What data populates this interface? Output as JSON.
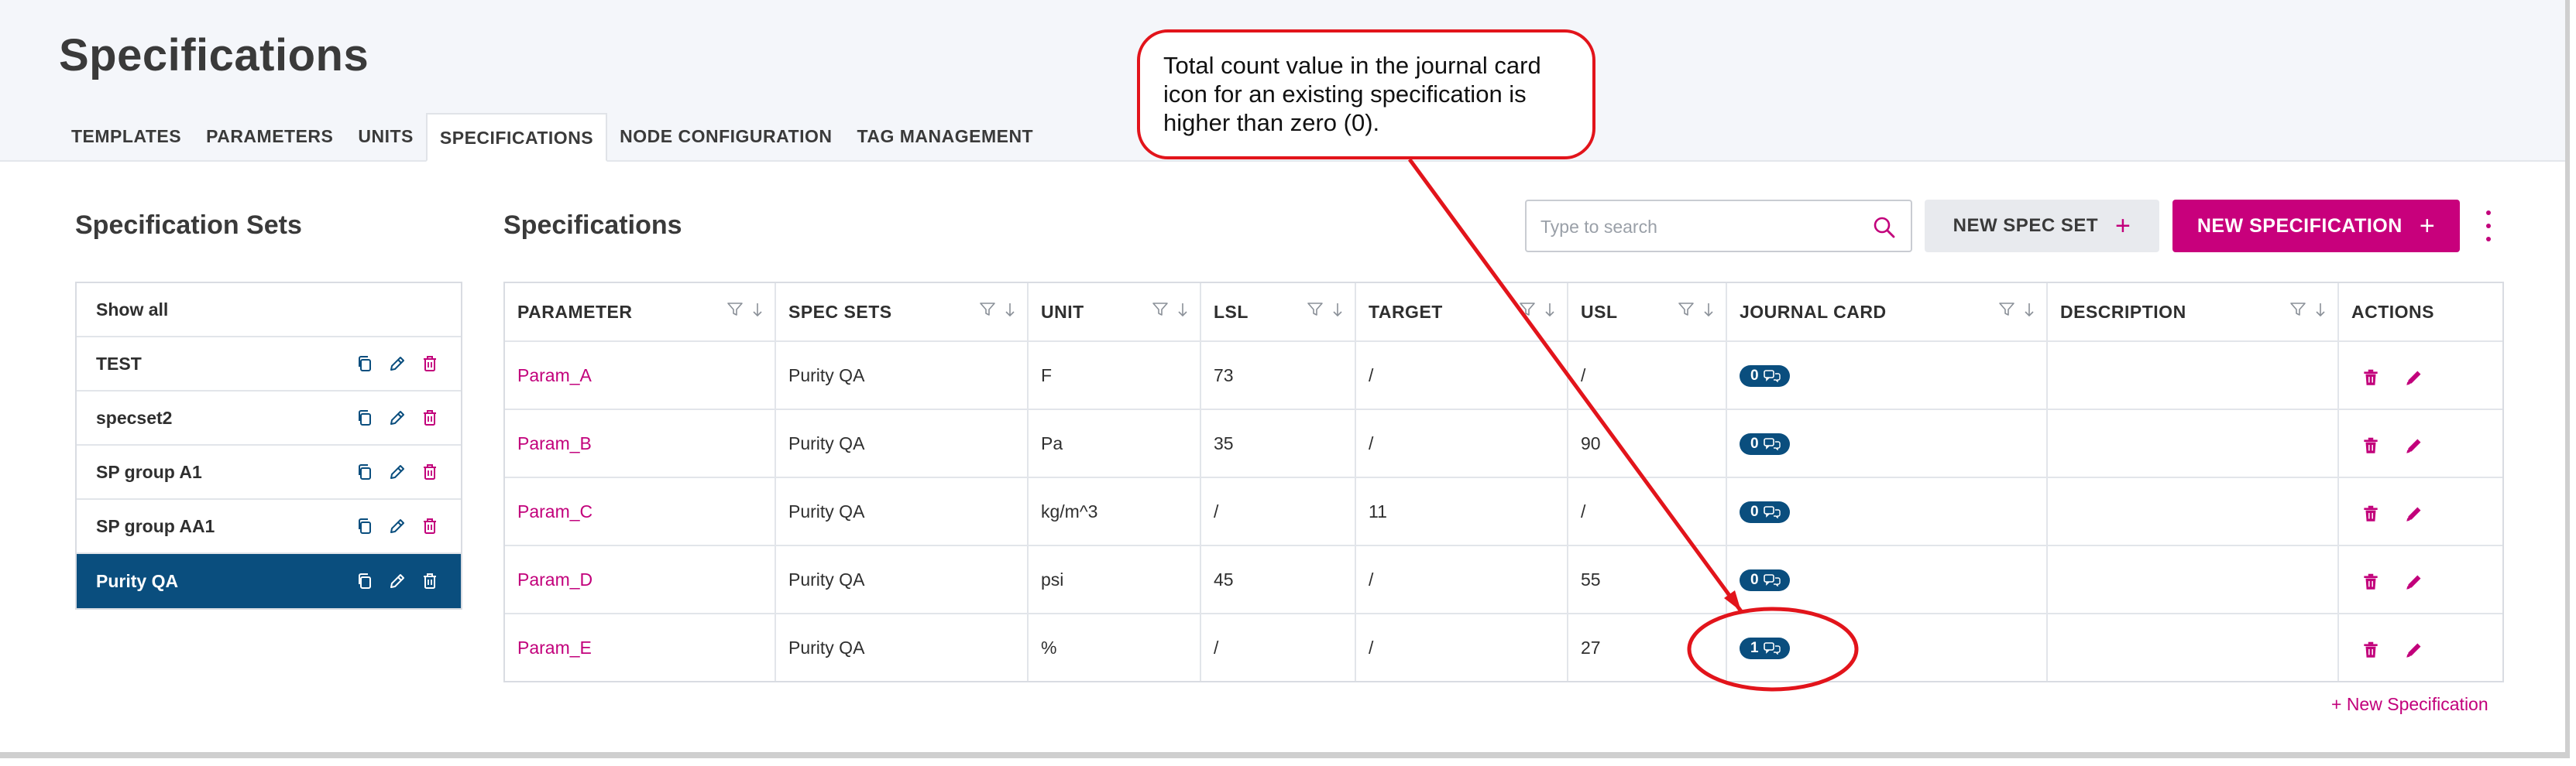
{
  "page": {
    "title": "Specifications"
  },
  "tabs": [
    "TEMPLATES",
    "PARAMETERS",
    "UNITS",
    "SPECIFICATIONS",
    "NODE CONFIGURATION",
    "TAG MANAGEMENT"
  ],
  "active_tab": "SPECIFICATIONS",
  "sets_panel": {
    "title": "Specification Sets",
    "items": [
      {
        "label": "Show all",
        "selected": false,
        "has_actions": false
      },
      {
        "label": "TEST",
        "selected": false,
        "has_actions": true
      },
      {
        "label": "specset2",
        "selected": false,
        "has_actions": true
      },
      {
        "label": "SP group A1",
        "selected": false,
        "has_actions": true
      },
      {
        "label": "SP group AA1",
        "selected": false,
        "has_actions": true
      },
      {
        "label": "Purity QA",
        "selected": true,
        "has_actions": true
      }
    ]
  },
  "specs_panel": {
    "title": "Specifications",
    "search_placeholder": "Type to search",
    "new_spec_set_label": "NEW SPEC SET",
    "new_spec_label": "NEW SPECIFICATION",
    "plus": "+",
    "columns": [
      "PARAMETER",
      "SPEC SETS",
      "UNIT",
      "LSL",
      "TARGET",
      "USL",
      "JOURNAL CARD",
      "DESCRIPTION",
      "ACTIONS"
    ],
    "rows": [
      {
        "parameter": "Param_A",
        "spec_sets": "Purity QA",
        "unit": "F",
        "lsl": "73",
        "target": "/",
        "usl": "/",
        "journal": "0",
        "description": ""
      },
      {
        "parameter": "Param_B",
        "spec_sets": "Purity QA",
        "unit": "Pa",
        "lsl": "35",
        "target": "/",
        "usl": "90",
        "journal": "0",
        "description": ""
      },
      {
        "parameter": "Param_C",
        "spec_sets": "Purity QA",
        "unit": "kg/m^3",
        "lsl": "/",
        "target": "11",
        "usl": "/",
        "journal": "0",
        "description": ""
      },
      {
        "parameter": "Param_D",
        "spec_sets": "Purity QA",
        "unit": "psi",
        "lsl": "45",
        "target": "/",
        "usl": "55",
        "journal": "0",
        "description": ""
      },
      {
        "parameter": "Param_E",
        "spec_sets": "Purity QA",
        "unit": "%",
        "lsl": "/",
        "target": "/",
        "usl": "27",
        "journal": "1",
        "description": ""
      }
    ],
    "new_spec_link": "+ New Specification"
  },
  "annotation": {
    "text": "Total count value in the journal card icon for an existing specification is higher than zero (0)."
  },
  "colors": {
    "accent": "#c2007b",
    "selected": "#0a4e7e",
    "callout": "#e2141b"
  },
  "icons": [
    "copy-icon",
    "pencil-icon",
    "trash-icon",
    "filter-icon",
    "sort-arrow-icon",
    "search-icon",
    "comment-icon",
    "kebab-menu-icon"
  ]
}
